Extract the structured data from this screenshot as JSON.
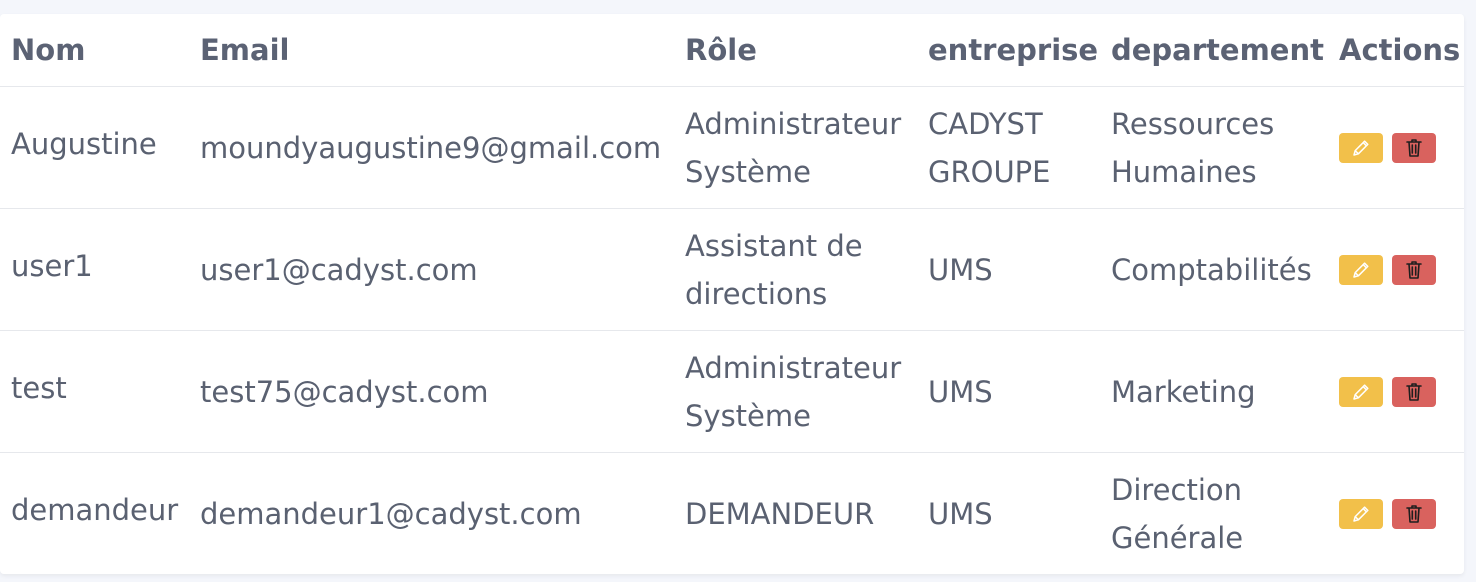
{
  "table": {
    "headers": [
      "Nom",
      "Email",
      "Rôle",
      "entreprise",
      "departement",
      "Actions"
    ],
    "rows": [
      {
        "nom": "Augustine",
        "email": "moundyaugustine9@gmail.com",
        "role": [
          "Administrateur",
          "Système"
        ],
        "entreprise": [
          "CADYST",
          "GROUPE"
        ],
        "departement": [
          "Ressources",
          "Humaines"
        ]
      },
      {
        "nom": "user1",
        "email": "user1@cadyst.com",
        "role": [
          "Assistant de",
          "directions"
        ],
        "entreprise": [
          "UMS"
        ],
        "departement": [
          "Comptabilités"
        ]
      },
      {
        "nom": "test",
        "email": "test75@cadyst.com",
        "role": [
          "Administrateur",
          "Système"
        ],
        "entreprise": [
          "UMS"
        ],
        "departement": [
          "Marketing"
        ]
      },
      {
        "nom": "demandeur",
        "email": "demandeur1@cadyst.com",
        "role": [
          "DEMANDEUR"
        ],
        "entreprise": [
          "UMS"
        ],
        "departement": [
          "Direction",
          "Générale"
        ]
      }
    ]
  },
  "actions": {
    "edit_icon": "pencil-icon",
    "delete_icon": "trash-icon"
  },
  "colors": {
    "edit_button": "#f2c04a",
    "delete_button": "#d9625e",
    "header_text": "#5b6274"
  }
}
